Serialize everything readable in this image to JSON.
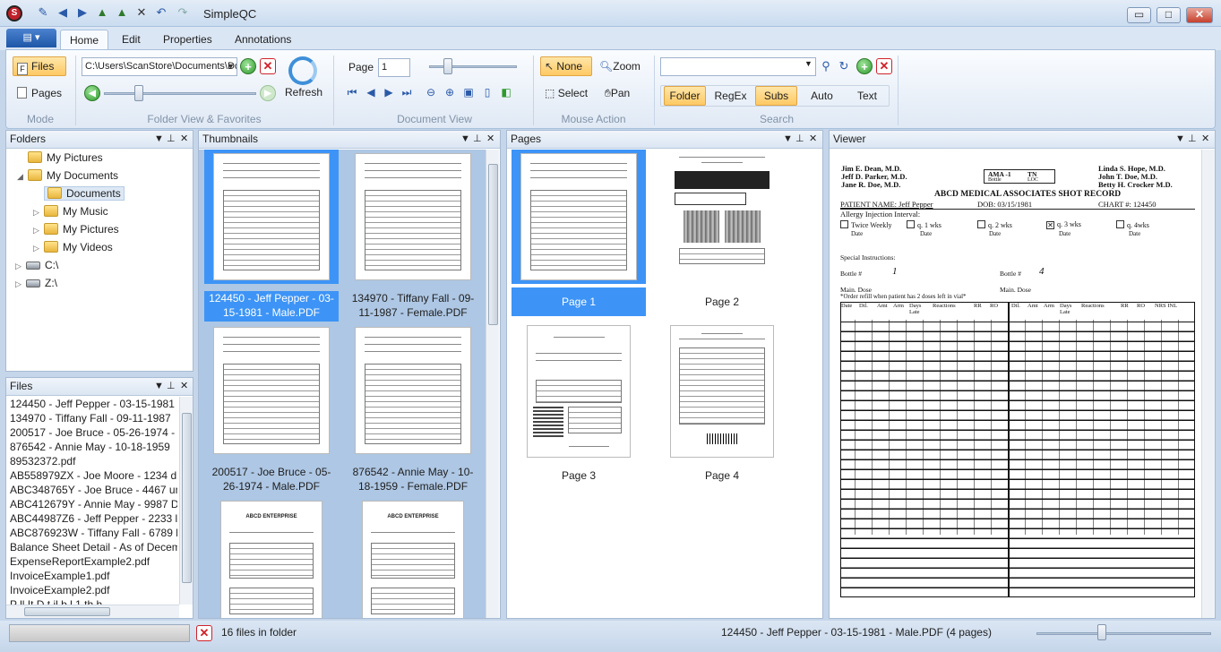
{
  "window": {
    "title": "SimpleQC",
    "minimize": "▭",
    "maximize": "□",
    "close": "✕"
  },
  "app_menu": {
    "label": "▤ ▾"
  },
  "tabs": [
    {
      "label": "Home",
      "active": true
    },
    {
      "label": "Edit"
    },
    {
      "label": "Properties"
    },
    {
      "label": "Annotations"
    }
  ],
  "ribbon": {
    "mode": {
      "files": "Files",
      "pages": "Pages",
      "group_label": "Mode"
    },
    "folder_view": {
      "path": "C:\\Users\\ScanStore\\Documents\\Do",
      "refresh": "Refresh",
      "group_label": "Folder View & Favorites"
    },
    "document_view": {
      "page_label": "Page",
      "page_value": "1",
      "group_label": "Document View"
    },
    "mouse_action": {
      "none": "None",
      "zoom": "Zoom",
      "select": "Select",
      "pan": "Pan",
      "group_label": "Mouse Action"
    },
    "search": {
      "value": "",
      "folder": "Folder",
      "regex": "RegEx",
      "subs": "Subs",
      "auto": "Auto",
      "text": "Text",
      "group_label": "Search"
    }
  },
  "panels": {
    "folders": {
      "title": "Folders"
    },
    "files": {
      "title": "Files"
    },
    "thumbnails": {
      "title": "Thumbnails"
    },
    "pages": {
      "title": "Pages"
    },
    "viewer": {
      "title": "Viewer"
    }
  },
  "folders": [
    {
      "label": "My Pictures"
    },
    {
      "label": "My Documents"
    },
    {
      "label": "Documents"
    },
    {
      "label": "My Music"
    },
    {
      "label": "My Pictures"
    },
    {
      "label": "My Videos"
    },
    {
      "label": "C:\\"
    },
    {
      "label": "Z:\\"
    }
  ],
  "files": [
    "124450 - Jeff Pepper - 03-15-1981",
    "134970 - Tiffany Fall - 09-11-1987",
    "200517 - Joe Bruce - 05-26-1974 -",
    "876542 - Annie May - 10-18-1959",
    "89532372.pdf",
    "AB558979ZX - Joe Moore - 1234 d",
    "ABC348765Y - Joe Bruce - 4467 un",
    "ABC412679Y - Annie May - 9987 D",
    "ABC44987Z6 - Jeff Pepper - 2233 lo",
    "ABC876923W - Tiffany Fall - 6789 l",
    "Balance Sheet Detail - As of Decem",
    "ExpenseReportExample2.pdf",
    "InvoiceExample1.pdf",
    "InvoiceExample2.pdf",
    "P     ll It     D t  il b  l  1 th   h"
  ],
  "thumbnails": [
    {
      "caption": "124450 - Jeff Pepper - 03-15-1981 - Male.PDF",
      "selected": true
    },
    {
      "caption": "134970 - Tiffany Fall - 09-11-1987 - Female.PDF"
    },
    {
      "caption": "200517 - Joe Bruce - 05-26-1974 - Male.PDF"
    },
    {
      "caption": "876542 - Annie May - 10-18-1959 - Female.PDF"
    },
    {
      "caption": "ABCD ENTERPRISE"
    },
    {
      "caption": "ABCD ENTERPRISE"
    }
  ],
  "pages": [
    {
      "caption": "Page 1",
      "selected": true
    },
    {
      "caption": "Page 2"
    },
    {
      "caption": "Page 3"
    },
    {
      "caption": "Page 4"
    }
  ],
  "viewer": {
    "doctors_left": [
      "Jim E. Dean, M.D.",
      "Jeff D. Parker, M.D.",
      "Jane R. Doe, M.D."
    ],
    "doctors_right": [
      "Linda S. Hope, M.D.",
      "John T. Doe, M.D.",
      "Betty H. Crocker M.D."
    ],
    "ama": "AMA -1",
    "tn": "TN",
    "bottle": "Bottle",
    "loc": "LOC",
    "heading": "ABCD MEDICAL ASSOCIATES SHOT RECORD",
    "patient": "PATIENT NAME: Jeff Pepper",
    "dob": "DOB: 03/15/1981",
    "chart": "CHART #: 124450",
    "allergy": "Allergy Injection Interval:",
    "intervals": [
      "Twice Weekly",
      "q. 1 wks",
      "q. 2 wks",
      "q. 3 wks",
      "q. 4wks"
    ],
    "date_label": "Date",
    "special": "Special Instructions:",
    "bottle_label": "Bottle #",
    "bottle_left": "1",
    "bottle_right": "4",
    "main_dose": "Main. Dose",
    "refill_note": "*Order refill when patient has 2 doses left in vial*",
    "columns": [
      "Date",
      "Dil.",
      "Amt",
      "Arm",
      "Days Late",
      "Reactions",
      "RR",
      "RO",
      "Dil.",
      "Amt",
      "Arm",
      "Days Late",
      "Reactions",
      "RR",
      "RO",
      "NRS INL"
    ]
  },
  "status": {
    "files_count": "16 files in folder",
    "document": "124450 - Jeff Pepper - 03-15-1981 - Male.PDF (4 pages)"
  }
}
